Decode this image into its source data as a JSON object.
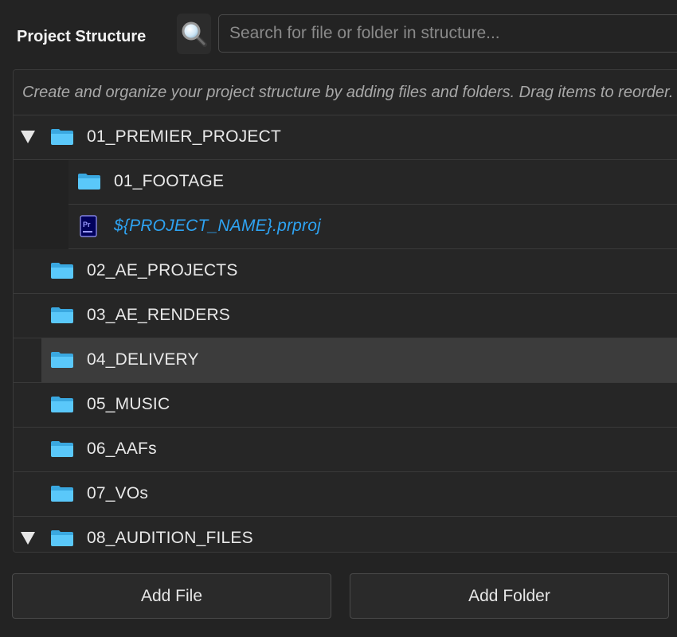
{
  "header": {
    "title": "Project Structure",
    "search_icon": "magnifying-glass-icon",
    "search_placeholder": "Search for file or folder in structure...",
    "search_value": ""
  },
  "panel": {
    "hint": "Create and organize your project structure by adding files and folders. Drag items to reorder."
  },
  "tree": {
    "items": [
      {
        "label": "01_PREMIER_PROJECT",
        "type": "folder",
        "depth": 0,
        "expanded": true,
        "selected": false
      },
      {
        "label": "01_FOOTAGE",
        "type": "folder",
        "depth": 1,
        "expanded": null,
        "selected": false
      },
      {
        "label": "${PROJECT_NAME}.prproj",
        "type": "file",
        "icon": "premiere-pro-file-icon",
        "depth": 1,
        "expanded": null,
        "selected": false
      },
      {
        "label": "02_AE_PROJECTS",
        "type": "folder",
        "depth": 0,
        "expanded": null,
        "selected": false
      },
      {
        "label": "03_AE_RENDERS",
        "type": "folder",
        "depth": 0,
        "expanded": null,
        "selected": false
      },
      {
        "label": "04_DELIVERY",
        "type": "folder",
        "depth": 0,
        "expanded": null,
        "selected": true
      },
      {
        "label": "05_MUSIC",
        "type": "folder",
        "depth": 0,
        "expanded": null,
        "selected": false
      },
      {
        "label": "06_AAFs",
        "type": "folder",
        "depth": 0,
        "expanded": null,
        "selected": false
      },
      {
        "label": "07_VOs",
        "type": "folder",
        "depth": 0,
        "expanded": null,
        "selected": false
      },
      {
        "label": "08_AUDITION_FILES",
        "type": "folder",
        "depth": 0,
        "expanded": true,
        "selected": false
      }
    ]
  },
  "buttons": {
    "add_file": "Add File",
    "add_folder": "Add Folder"
  },
  "colors": {
    "background": "#232323",
    "folder": "#5ac8fa",
    "file_text": "#2ea3f2",
    "selected_row": "#3c3c3c"
  }
}
